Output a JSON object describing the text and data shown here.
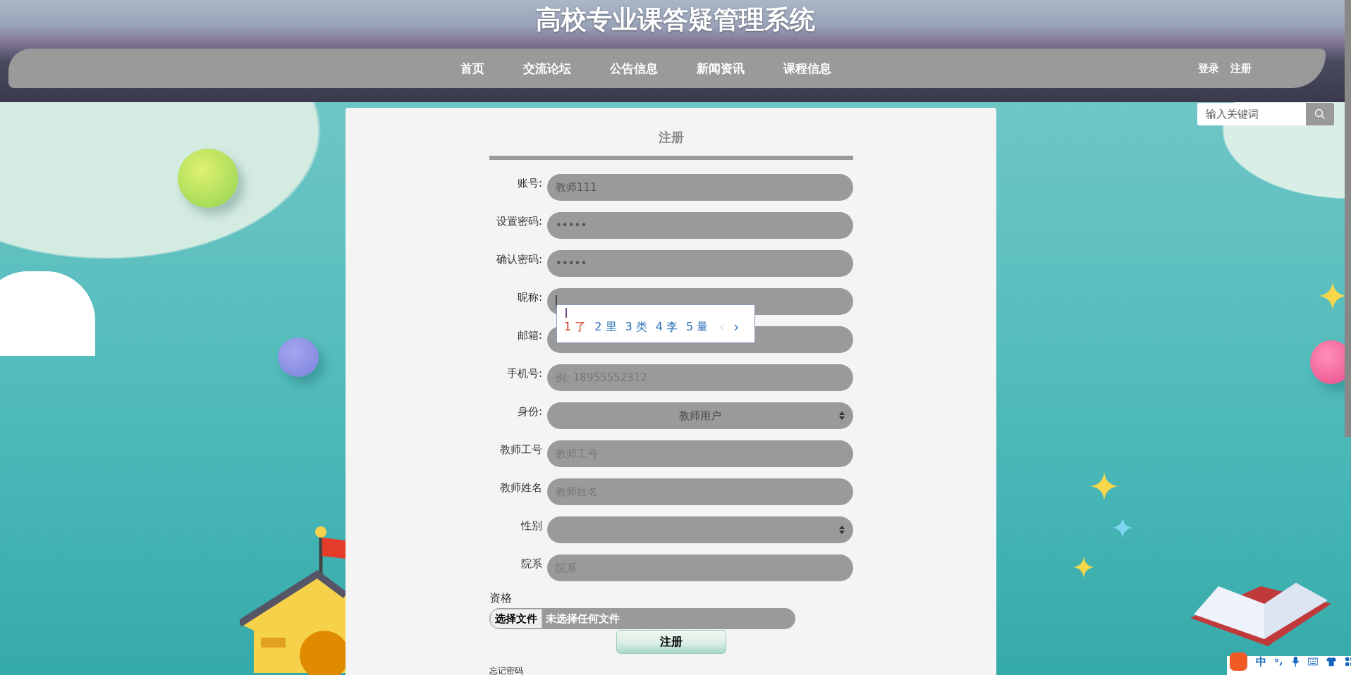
{
  "header": {
    "title": "高校专业课答疑管理系统",
    "nav": [
      {
        "label": "首页"
      },
      {
        "label": "交流论坛"
      },
      {
        "label": "公告信息"
      },
      {
        "label": "新闻资讯"
      },
      {
        "label": "课程信息"
      }
    ],
    "auth_links": [
      {
        "label": "登录"
      },
      {
        "label": "注册"
      }
    ]
  },
  "search": {
    "placeholder": "输入关键词"
  },
  "form": {
    "title": "注册",
    "fields": [
      {
        "kind": "text",
        "label": "账号:",
        "value": "教师111"
      },
      {
        "kind": "text",
        "label": "设置密码:",
        "value": "•••••"
      },
      {
        "kind": "text",
        "label": "确认密码:",
        "value": "•••••"
      },
      {
        "kind": "text",
        "label": "昵称:",
        "focused": true
      },
      {
        "kind": "text",
        "label": "邮箱:"
      },
      {
        "kind": "text",
        "label": "手机号:",
        "placeholder": "例: 18955552312"
      },
      {
        "kind": "select",
        "label": "身份:",
        "value": "教师用户"
      },
      {
        "kind": "text",
        "label": "教师工号",
        "placeholder": "教师工号"
      },
      {
        "kind": "text",
        "label": "教师姓名",
        "placeholder": "教师姓名"
      },
      {
        "kind": "select",
        "label": "性别"
      },
      {
        "kind": "text",
        "label": "院系",
        "placeholder": "院系"
      }
    ],
    "file": {
      "label": "资格",
      "button": "选择文件",
      "status": "未选择任何文件"
    },
    "submit": "注册",
    "forgot_link": "忘记密码"
  },
  "ime_popup": {
    "candidates": [
      {
        "number": "1",
        "char": "了",
        "selected": true
      },
      {
        "number": "2",
        "char": "里",
        "selected": false
      },
      {
        "number": "3",
        "char": "类",
        "selected": false
      },
      {
        "number": "4",
        "char": "李",
        "selected": false
      },
      {
        "number": "5",
        "char": "量",
        "selected": false
      }
    ]
  },
  "ime_toolbar": {
    "mode": "中"
  }
}
